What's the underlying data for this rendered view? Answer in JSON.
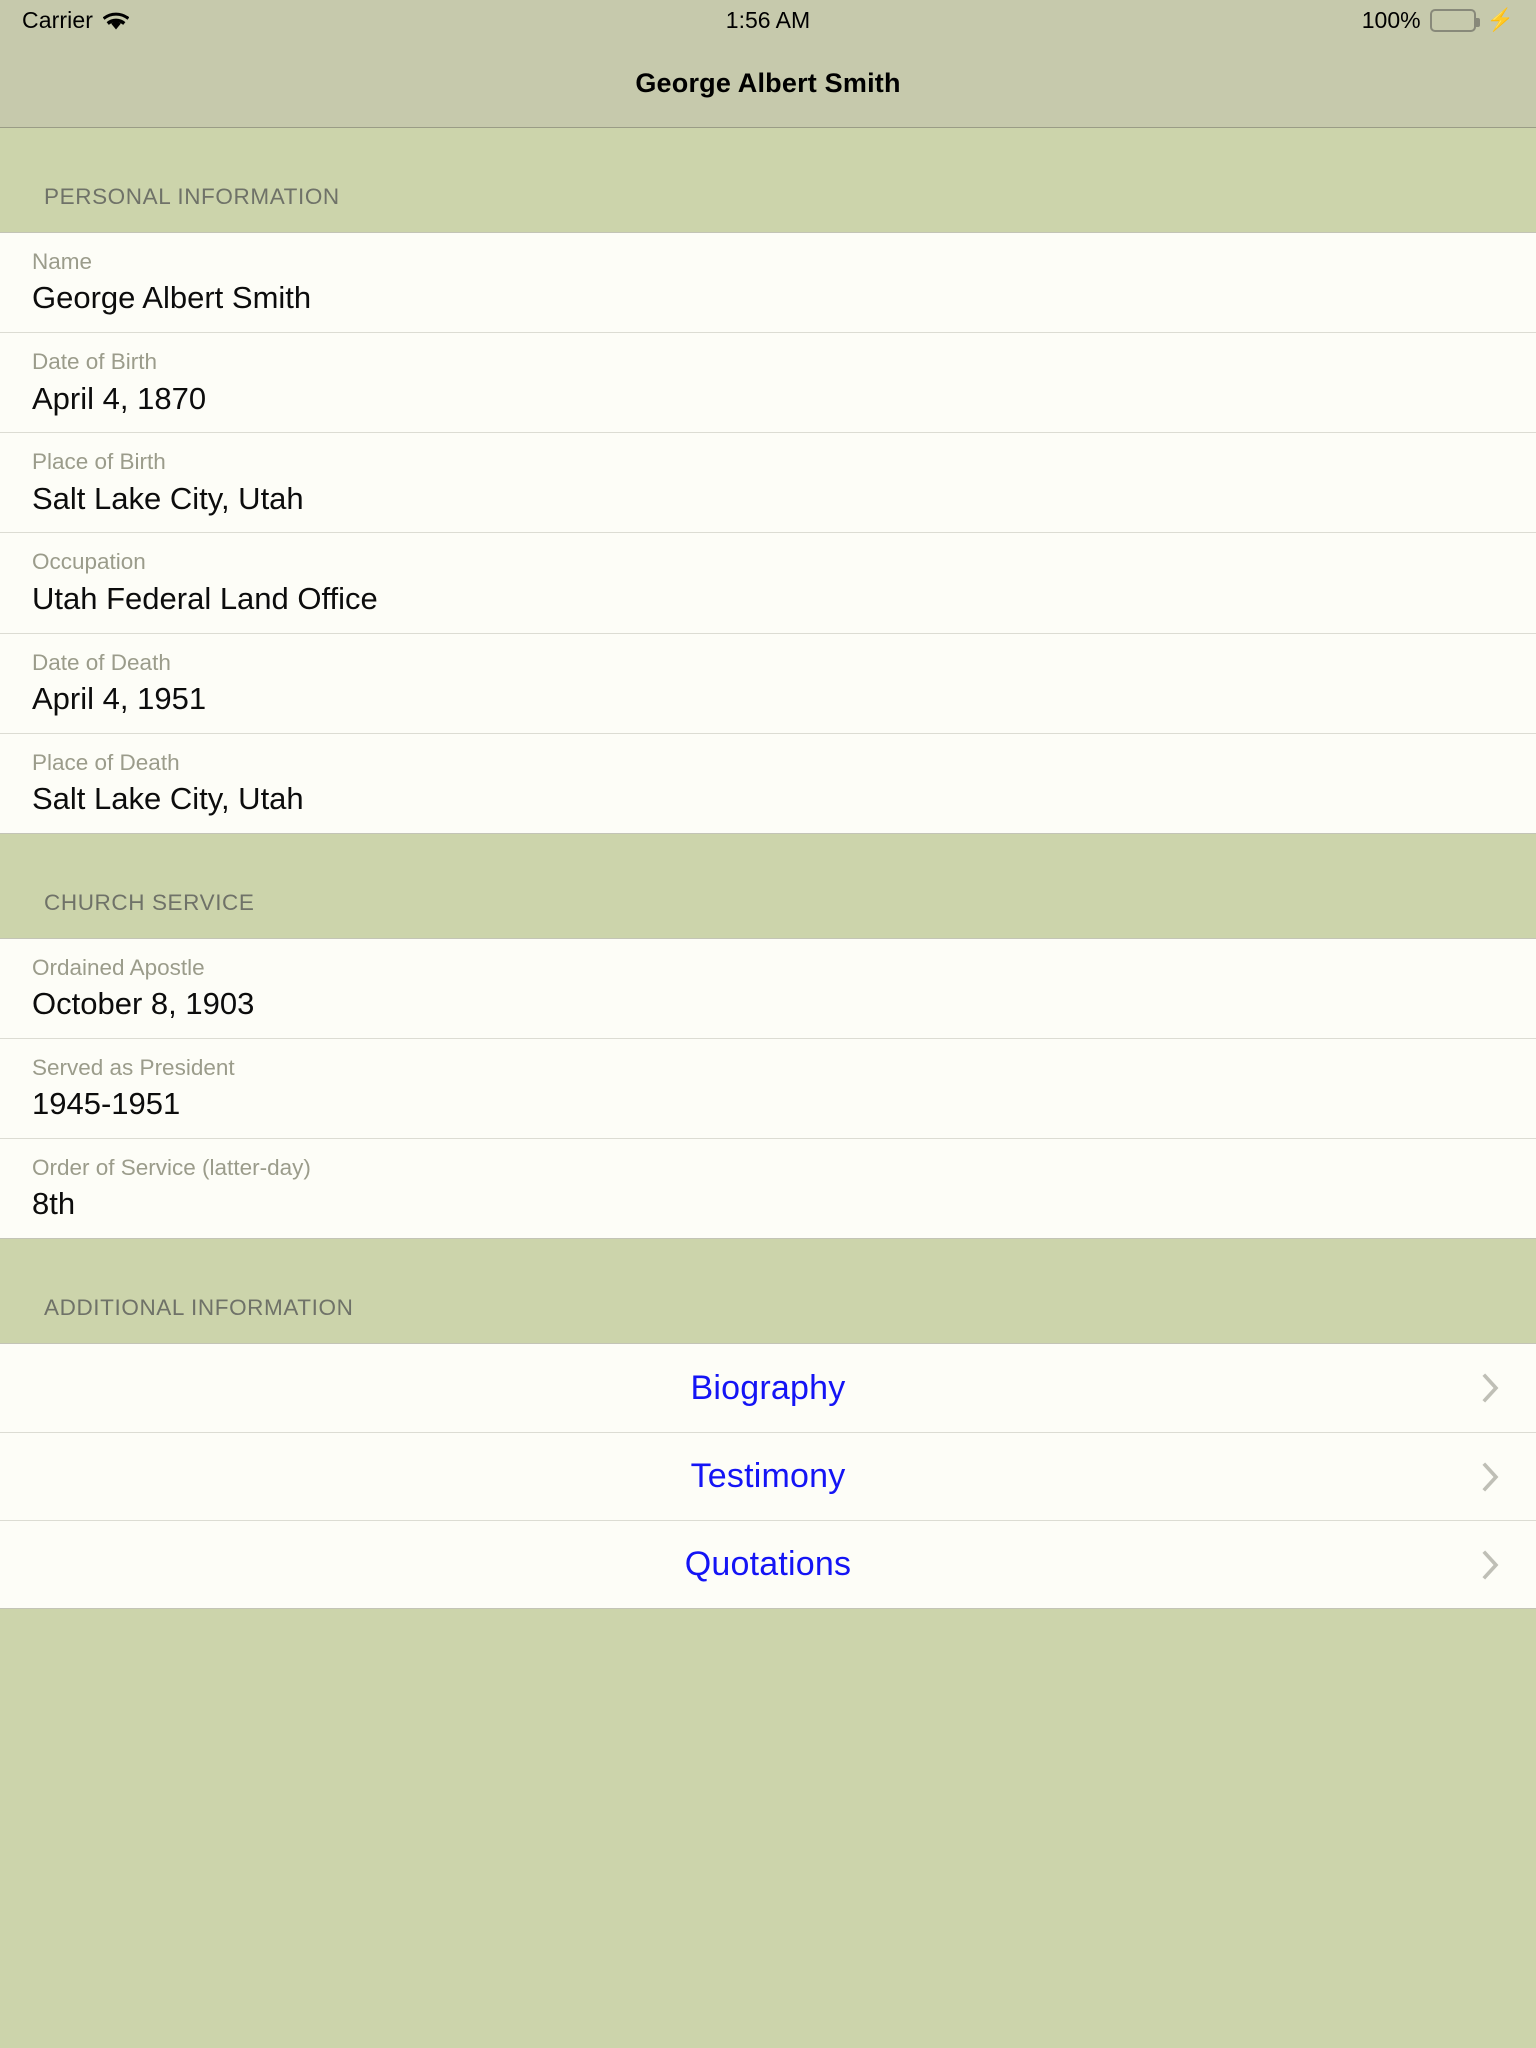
{
  "status_bar": {
    "carrier": "Carrier",
    "wifi_icon": "wifi-icon",
    "time": "1:56 AM",
    "battery_percent": "100%",
    "battery_icon": "battery-full-icon",
    "charging_icon": "lightning-bolt-icon"
  },
  "nav_bar": {
    "title": "George Albert Smith"
  },
  "sections": [
    {
      "header": "PERSONAL INFORMATION",
      "rows": [
        {
          "label": "Name",
          "value": "George Albert Smith"
        },
        {
          "label": "Date of Birth",
          "value": "April 4, 1870"
        },
        {
          "label": "Place of Birth",
          "value": "Salt Lake City, Utah"
        },
        {
          "label": "Occupation",
          "value": "Utah Federal Land Office"
        },
        {
          "label": "Date of Death",
          "value": "April 4, 1951"
        },
        {
          "label": "Place of Death",
          "value": "Salt Lake City, Utah"
        }
      ]
    },
    {
      "header": "CHURCH SERVICE",
      "rows": [
        {
          "label": "Ordained Apostle",
          "value": "October 8, 1903"
        },
        {
          "label": "Served as President",
          "value": "1945-1951"
        },
        {
          "label": "Order of Service (latter-day)",
          "value": "8th"
        }
      ]
    },
    {
      "header": "ADDITIONAL INFORMATION",
      "links": [
        {
          "label": "Biography",
          "accessory": "chevron-right-icon"
        },
        {
          "label": "Testimony",
          "accessory": "chevron-right-icon"
        },
        {
          "label": "Quotations",
          "accessory": "chevron-right-icon"
        }
      ]
    }
  ],
  "colors": {
    "background": "#ccd4ab",
    "bar": "#c6c9ac",
    "cell": "#fdfdf7",
    "link": "#1414f5",
    "label": "#9b9c8b",
    "section_header": "#6f7268",
    "battery_green": "#4cd964"
  }
}
